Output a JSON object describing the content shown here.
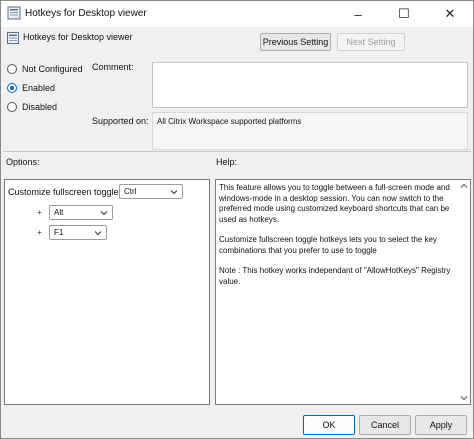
{
  "window": {
    "title": "Hotkeys for Desktop viewer",
    "controls": {
      "minimize": "–",
      "maximize": "☐",
      "close": "✕"
    }
  },
  "header": {
    "policy_name": "Hotkeys for Desktop viewer",
    "prev_label": "Previous Setting",
    "next_label": "Next Setting"
  },
  "state": {
    "options": [
      {
        "label": "Not Configured",
        "checked": false
      },
      {
        "label": "Enabled",
        "checked": true
      },
      {
        "label": "Disabled",
        "checked": false
      }
    ]
  },
  "comment": {
    "label": "Comment:",
    "value": ""
  },
  "supported": {
    "label": "Supported on:",
    "value": "All Citrix Workspace supported platforms"
  },
  "options_panel": {
    "label": "Options:",
    "toggle_label": "Customize fullscreen toggle:",
    "selects": [
      {
        "value": "Ctrl"
      },
      {
        "value": "Alt"
      },
      {
        "value": "F1"
      }
    ],
    "plus": "+"
  },
  "help": {
    "label": "Help:",
    "paragraphs": [
      "This feature allows you to toggle between a full-screen mode and windows-mode in a desktop session. You can now switch to the preferred mode using customized keyboard shortcuts that can be used as hotkeys.",
      "Customize fullscreen toggle hotkeys lets you to select the key combinations that you prefer to use to toggle",
      "Note : This hotkey works independant of \"AllowHotKeys\" Registry value."
    ]
  },
  "footer": {
    "ok": "OK",
    "cancel": "Cancel",
    "apply": "Apply"
  }
}
